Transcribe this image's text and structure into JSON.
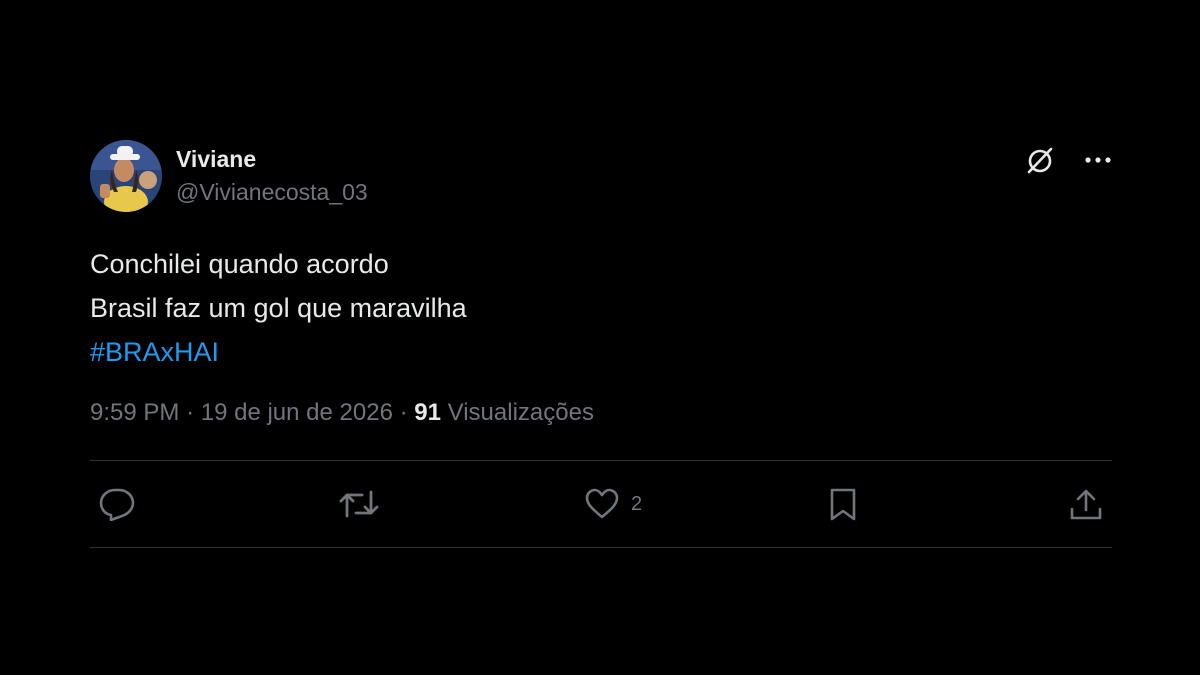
{
  "colors": {
    "background": "#000000",
    "text_primary": "#e7e9ea",
    "text_secondary": "#71767b",
    "accent": "#1d9bf0",
    "divider": "#2f3336"
  },
  "author": {
    "display_name": "Viviane",
    "handle": "@Vivianecosta_03",
    "avatar_icon": "profile-photo"
  },
  "header_actions": {
    "grok_icon": "grok-slash-icon",
    "more_icon": "more-dots-icon"
  },
  "tweet": {
    "lines": [
      "Conchilei quando acordo",
      "Brasil faz um gol que maravilha"
    ],
    "hashtag": "#BRAxHAI"
  },
  "meta": {
    "time": "9:59 PM",
    "separator": "·",
    "date": "19 de jun de 2026",
    "views_count": "91",
    "views_label": "Visualizações"
  },
  "actions": {
    "reply": {
      "icon": "reply-icon",
      "count": ""
    },
    "retweet": {
      "icon": "retweet-icon",
      "count": ""
    },
    "like": {
      "icon": "heart-icon",
      "count": "2"
    },
    "bookmark": {
      "icon": "bookmark-icon",
      "count": ""
    },
    "share": {
      "icon": "share-icon",
      "count": ""
    }
  }
}
